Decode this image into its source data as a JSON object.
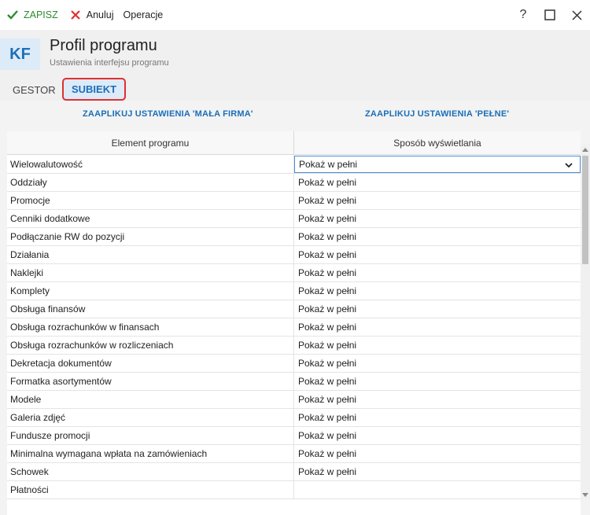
{
  "toolbar": {
    "save_label": "ZAPISZ",
    "cancel_label": "Anuluj",
    "operations_label": "Operacje"
  },
  "window": {
    "help_glyph": "?",
    "colors": {
      "save": "#2e8b2e",
      "cancel": "#e0302f",
      "accent": "#1a6fb8",
      "highlight": "#e0302f"
    }
  },
  "header": {
    "badge": "KF",
    "title": "Profil programu",
    "subtitle": "Ustawienia interfejsu programu"
  },
  "tabs": [
    {
      "label": "GESTOR",
      "active": false
    },
    {
      "label": "SUBIEKT",
      "active": true
    }
  ],
  "actions": {
    "apply_small": "ZAAPLIKUJ USTAWIENIA 'MAŁA FIRMA'",
    "apply_full": "ZAAPLIKUJ USTAWIENIA 'PEŁNE'"
  },
  "grid": {
    "columns": [
      "Element programu",
      "Sposób wyświetlania"
    ],
    "rows": [
      {
        "name": "Wielowalutowość",
        "value": "Pokaż w pełni"
      },
      {
        "name": "Oddziały",
        "value": "Pokaż w pełni"
      },
      {
        "name": "Promocje",
        "value": "Pokaż w pełni"
      },
      {
        "name": "Cenniki dodatkowe",
        "value": "Pokaż w pełni"
      },
      {
        "name": "Podłączanie RW do pozycji",
        "value": "Pokaż w pełni"
      },
      {
        "name": "Działania",
        "value": "Pokaż w pełni"
      },
      {
        "name": "Naklejki",
        "value": "Pokaż w pełni"
      },
      {
        "name": "Komplety",
        "value": "Pokaż w pełni"
      },
      {
        "name": "Obsługa finansów",
        "value": "Pokaż w pełni"
      },
      {
        "name": "Obsługa rozrachunków w finansach",
        "value": "Pokaż w pełni"
      },
      {
        "name": "Obsługa rozrachunków w rozliczeniach",
        "value": "Pokaż w pełni"
      },
      {
        "name": "Dekretacja dokumentów",
        "value": "Pokaż w pełni"
      },
      {
        "name": "Formatka asortymentów",
        "value": "Pokaż w pełni"
      },
      {
        "name": "Modele",
        "value": "Pokaż w pełni"
      },
      {
        "name": "Galeria zdjęć",
        "value": "Pokaż w pełni"
      },
      {
        "name": "Fundusze promocji",
        "value": "Pokaż w pełni"
      },
      {
        "name": "Minimalna wymagana wpłata na zamówieniach",
        "value": "Pokaż w pełni"
      },
      {
        "name": "Schowek",
        "value": "Pokaż w pełni"
      },
      {
        "name": "Płatności",
        "value": ""
      }
    ]
  }
}
